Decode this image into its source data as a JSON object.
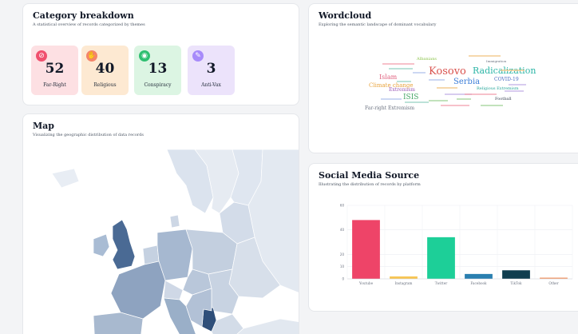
{
  "category": {
    "title": "Category breakdown",
    "subtitle": "A statistical overview of records categorized by themes",
    "tiles": [
      {
        "count": "52",
        "label": "Far-Right",
        "bg": "#fde0e3",
        "iconColor": "#f0506e",
        "icon": "no-symbol-icon"
      },
      {
        "count": "40",
        "label": "Religious",
        "bg": "#fde9d2",
        "iconColor": "#f4846a",
        "icon": "pray-icon"
      },
      {
        "count": "13",
        "label": "Conspiracy",
        "bg": "#dcf5e3",
        "iconColor": "#2fbf71",
        "icon": "eye-icon"
      },
      {
        "count": "3",
        "label": "Anti-Vax",
        "bg": "#ece3fb",
        "iconColor": "#a78bfa",
        "icon": "syringe-icon"
      }
    ]
  },
  "map": {
    "title": "Map",
    "subtitle": "Visualizing the geographic distribution of data records"
  },
  "wordcloud": {
    "title": "Wordcloud",
    "subtitle": "Exploring the semantic landscape of dominant vocabulary",
    "words": [
      {
        "text": "Kosovo",
        "color": "#d9534f"
      },
      {
        "text": "Radicalization",
        "color": "#2bb5a6"
      },
      {
        "text": "Serbia",
        "color": "#3b7dd8"
      },
      {
        "text": "Islam",
        "color": "#e0607e"
      },
      {
        "text": "Climate change",
        "color": "#e8a33d"
      },
      {
        "text": "ISIS",
        "color": "#4aa86a"
      },
      {
        "text": "COVID-19",
        "color": "#4b6cc1"
      },
      {
        "text": "Extremism",
        "color": "#9b59b6"
      },
      {
        "text": "Far-right Extremism",
        "color": "#6b7280"
      },
      {
        "text": "Albanians",
        "color": "#8bc34a"
      },
      {
        "text": "Religious Extremism",
        "color": "#26a69a"
      },
      {
        "text": "Football",
        "color": "#374151"
      },
      {
        "text": "Immigration",
        "color": "#6b7280"
      }
    ]
  },
  "social": {
    "title": "Social Media Source",
    "subtitle": "Illustrating the distribution of records by platform"
  },
  "chart_data": {
    "type": "bar",
    "categories": [
      "Youtube",
      "Instagram",
      "Twitter",
      "Facebook",
      "TikTok",
      "Other"
    ],
    "values": [
      48,
      2,
      34,
      4,
      7,
      1
    ],
    "colors": [
      "#ee4468",
      "#f7c553",
      "#1dcf98",
      "#2a7fb0",
      "#0f3d4f",
      "#f29a6a"
    ],
    "yticks": [
      "0",
      "10",
      "20",
      "40",
      "60"
    ],
    "ylim": [
      0,
      60
    ],
    "grid": true
  }
}
